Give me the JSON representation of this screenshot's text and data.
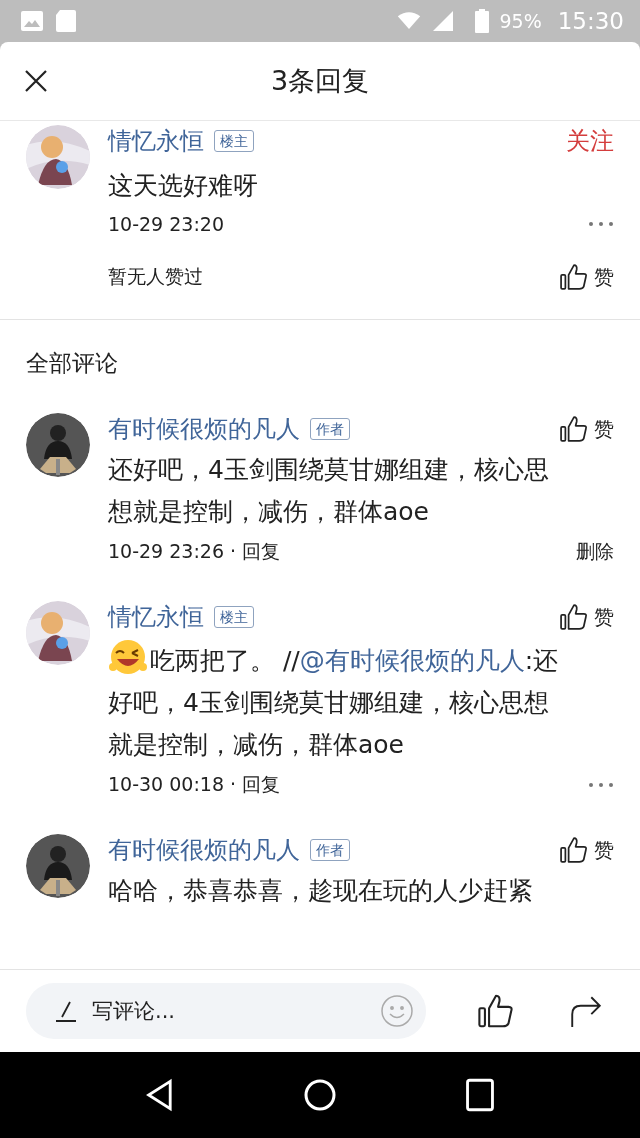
{
  "status_bar": {
    "battery": "95%",
    "time": "15:30"
  },
  "header": {
    "title": "3条回复"
  },
  "main_comment": {
    "author": "情忆永恒",
    "badge": "楼主",
    "follow": "关注",
    "text": "这天选好难呀",
    "time": "10-29 23:20",
    "likes_note": "暂无人赞过",
    "like_label": "赞"
  },
  "section_title": "全部评论",
  "comments": [
    {
      "author": "有时候很烦的凡人",
      "badge": "作者",
      "like_label": "赞",
      "emoji": false,
      "text": "还好吧，4玉剑围绕莫甘娜组建，核心思想就是控制，减伤，群体aoe",
      "time": "10-29 23:26 · 回复",
      "action": "删除"
    },
    {
      "author": "情忆永恒",
      "badge": "楼主",
      "like_label": "赞",
      "emoji": true,
      "text": "吃两把了。 //",
      "mention": "@有时候很烦的凡人",
      "quote": ":还好吧，4玉剑围绕莫甘娜组建，核心思想就是控制，减伤，群体aoe",
      "time": "10-30 00:18 · 回复"
    },
    {
      "author": "有时候很烦的凡人",
      "badge": "作者",
      "like_label": "赞",
      "emoji": false,
      "text": "哈哈，恭喜恭喜，趁现在玩的人少赶紧"
    }
  ],
  "composer": {
    "placeholder": "写评论..."
  }
}
